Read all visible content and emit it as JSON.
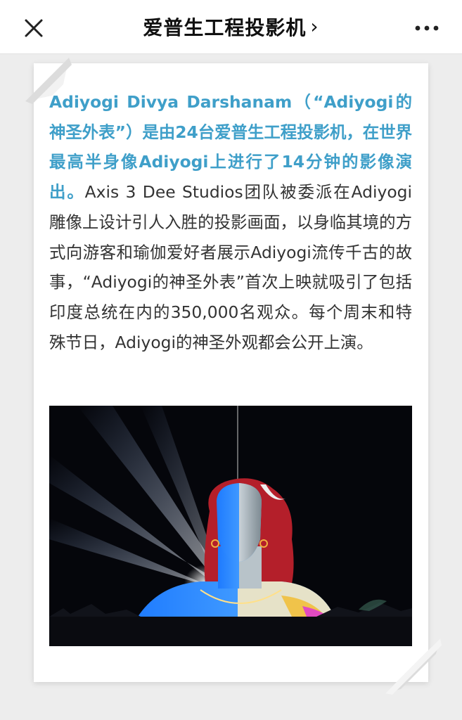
{
  "header": {
    "title": "爱普生工程投影机",
    "chevron": "›",
    "close_icon": "close-icon",
    "more_icon": "more-icon"
  },
  "article": {
    "highlight": "Adiyogi Divya Darshanam（“Adiyogi的神圣外表”）是由24台爱普生工程投影机，在世界最高半身像Adiyogi上进行了14分钟的影像演出。",
    "body": "Axis 3 Dee Studios团队被委派在Adiyogi雕像上设计引人入胜的投影画面，以身临其境的方式向游客和瑜伽爱好者展示Adiyogi流传千古的故事，“Adiyogi的神圣外表”首次上映就吸引了包括印度总统在内的350,000名观众。每个周末和特殊节日，Adiyogi的神圣外观都会公开上演。"
  },
  "colors": {
    "highlight": "#3f9fc9",
    "text": "#333333",
    "background": "#ededed"
  }
}
